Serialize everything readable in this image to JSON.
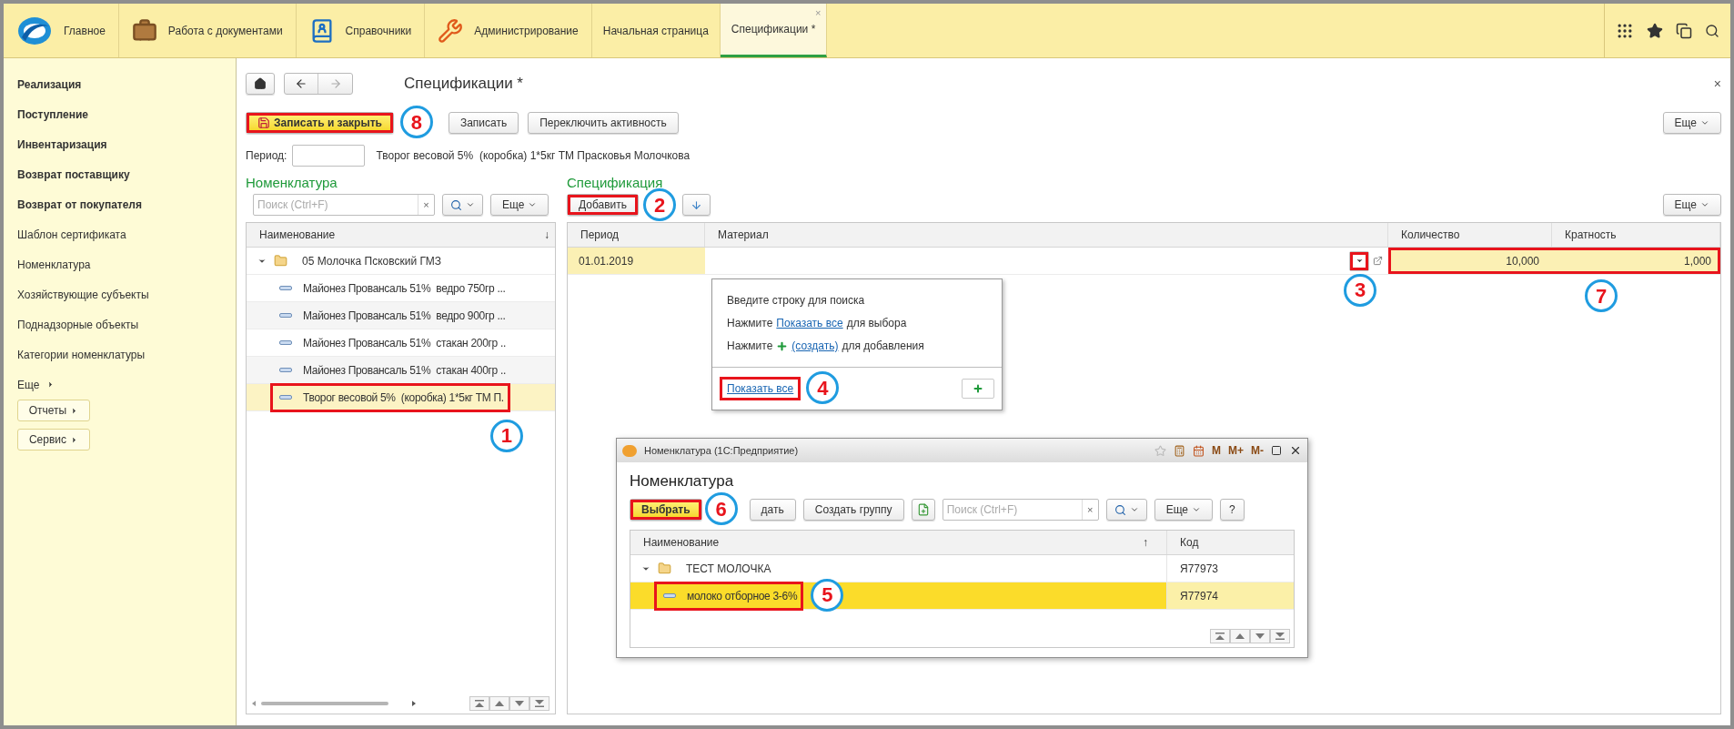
{
  "top_bar": {
    "sections": [
      {
        "label": "Главное"
      },
      {
        "label": "Работа с документами"
      },
      {
        "label": "Справочники"
      },
      {
        "label": "Администрирование"
      }
    ],
    "tabs": [
      {
        "label": "Начальная страница",
        "selected": false
      },
      {
        "label": "Спецификации *",
        "selected": true
      }
    ],
    "tab_close": "×"
  },
  "sidebar": {
    "items": [
      {
        "label": "Реализация",
        "bold": true
      },
      {
        "label": "Поступление",
        "bold": true
      },
      {
        "label": "Инвентаризация",
        "bold": true
      },
      {
        "label": "Возврат поставщику",
        "bold": true
      },
      {
        "label": "Возврат от покупателя",
        "bold": true
      },
      {
        "label": "Шаблон сертификата",
        "bold": false
      },
      {
        "label": "Номенклатура",
        "bold": false
      },
      {
        "label": "Хозяйствующие субъекты",
        "bold": false
      },
      {
        "label": "Поднадзорные объекты",
        "bold": false
      },
      {
        "label": "Категории номенклатуры",
        "bold": false
      }
    ],
    "more": "Еще",
    "buttons": [
      "Отчеты",
      "Сервис"
    ]
  },
  "form": {
    "title": "Спецификации *",
    "close": "×",
    "toolbar": [
      {
        "label": "Записать и закрыть",
        "kind": "primary",
        "callout": "8"
      },
      {
        "label": "Записать",
        "kind": "normal"
      },
      {
        "label": "Переключить активность",
        "kind": "normal"
      }
    ],
    "more": "Еще",
    "period_label": "Период:",
    "caption": "Творог весовой 5%  (коробка) 1*5кг ТМ Прасковья Молочкова"
  },
  "nomenclature": {
    "title": "Номенклатура",
    "search_placeholder": "Поиск (Ctrl+F)",
    "clear": "×",
    "more": "Еще",
    "column": "Наименование",
    "sort": "↓",
    "tree": [
      {
        "label": "05 Молочка Псковский ГМЗ",
        "kind": "folder",
        "expanded": true,
        "selected": false,
        "children": [
          {
            "label": "Майонез Провансаль 51%  ведро 750гр ...",
            "kind": "item",
            "selected": false
          },
          {
            "label": "Майонез Провансаль 51%  ведро 900гр ...",
            "kind": "item",
            "selected": false
          },
          {
            "label": "Майонез Провансаль 51%  стакан 200гр ..",
            "kind": "item",
            "selected": false
          },
          {
            "label": "Майонез Провансаль 51%  стакан 400гр ..",
            "kind": "item",
            "selected": false
          },
          {
            "label": "Творог весовой 5%  (коробка) 1*5кг ТМ П.",
            "kind": "item",
            "selected": true,
            "callout": "1"
          }
        ]
      }
    ]
  },
  "specification": {
    "title": "Спецификация",
    "add": {
      "label": "Добавить",
      "callout": "2"
    },
    "more": "Еще",
    "columns": [
      "Период",
      "Материал",
      "Количество",
      "Кратность"
    ],
    "rows": [
      {
        "period": "01.01.2019",
        "quantity": "10,000",
        "multiplicity": "1,000",
        "selected": true,
        "choice_callout": "3",
        "values_callout": "7"
      }
    ]
  },
  "dropdown": {
    "lines": [
      {
        "before": "Введите строку для поиска",
        "plus": false
      },
      {
        "before": "Нажмите",
        "link": "Показать все",
        "after": "для выбора",
        "plus": false
      },
      {
        "before": "Нажмите",
        "link": "(создать)",
        "after": "для добавления",
        "plus": true
      }
    ],
    "footer_link": "Показать все",
    "footer_callout": "4"
  },
  "dialog": {
    "title": "Номенклатура (1С:Предприятие)",
    "heading": "Номенклатура",
    "memory_buttons": [
      "M",
      "M+",
      "M-"
    ],
    "toolbar": [
      {
        "label": "Выбрать",
        "kind": "primary",
        "callout": "6"
      },
      {
        "label": "дать",
        "kind": "normal"
      },
      {
        "label": "Создать группу",
        "kind": "normal"
      }
    ],
    "search_placeholder": "Поиск (Ctrl+F)",
    "clear": "×",
    "more": "Еще",
    "help": "?",
    "columns": [
      "Наименование",
      "Код"
    ],
    "sort": "↑",
    "tree": [
      {
        "label": "ТЕСТ МОЛОЧКА",
        "code": "Я77973",
        "kind": "folder",
        "expanded": true,
        "selected": false,
        "children": [
          {
            "label": "молоко отборное 3-6%",
            "code": "Я77974",
            "kind": "item",
            "selected": true,
            "callout": "5"
          }
        ]
      }
    ]
  }
}
